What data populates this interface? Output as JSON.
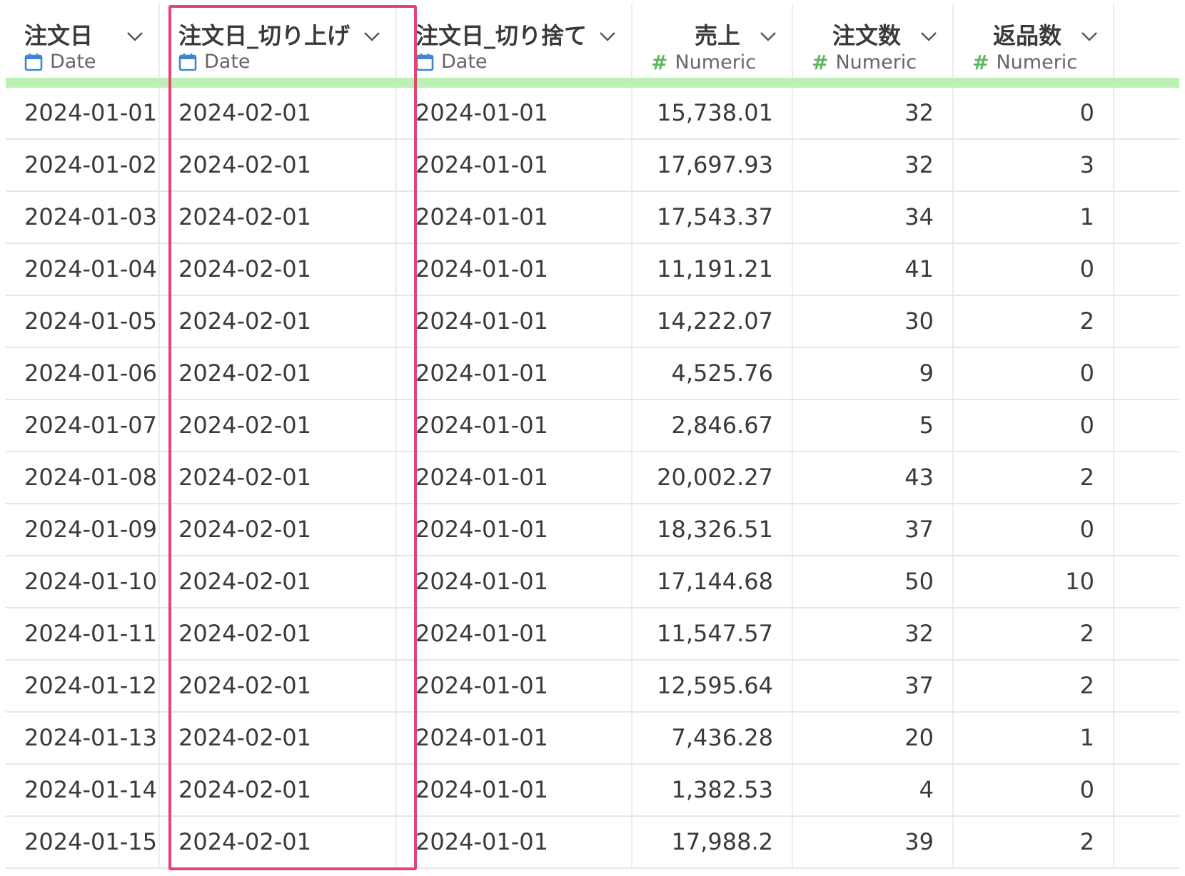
{
  "columns": [
    {
      "name": "注文日",
      "type": "Date",
      "icon": "calendar-icon",
      "align": "left"
    },
    {
      "name": "注文日_切り上げ",
      "type": "Date",
      "icon": "calendar-icon",
      "align": "left"
    },
    {
      "name": "注文日_切り捨て",
      "type": "Date",
      "icon": "calendar-icon",
      "align": "left"
    },
    {
      "name": "売上",
      "type": "Numeric",
      "icon": "hash-icon",
      "align": "right"
    },
    {
      "name": "注文数",
      "type": "Numeric",
      "icon": "hash-icon",
      "align": "right"
    },
    {
      "name": "返品数",
      "type": "Numeric",
      "icon": "hash-icon",
      "align": "right"
    }
  ],
  "rows": [
    [
      "2024-01-01",
      "2024-02-01",
      "2024-01-01",
      "15,738.01",
      "32",
      "0"
    ],
    [
      "2024-01-02",
      "2024-02-01",
      "2024-01-01",
      "17,697.93",
      "32",
      "3"
    ],
    [
      "2024-01-03",
      "2024-02-01",
      "2024-01-01",
      "17,543.37",
      "34",
      "1"
    ],
    [
      "2024-01-04",
      "2024-02-01",
      "2024-01-01",
      "11,191.21",
      "41",
      "0"
    ],
    [
      "2024-01-05",
      "2024-02-01",
      "2024-01-01",
      "14,222.07",
      "30",
      "2"
    ],
    [
      "2024-01-06",
      "2024-02-01",
      "2024-01-01",
      "4,525.76",
      "9",
      "0"
    ],
    [
      "2024-01-07",
      "2024-02-01",
      "2024-01-01",
      "2,846.67",
      "5",
      "0"
    ],
    [
      "2024-01-08",
      "2024-02-01",
      "2024-01-01",
      "20,002.27",
      "43",
      "2"
    ],
    [
      "2024-01-09",
      "2024-02-01",
      "2024-01-01",
      "18,326.51",
      "37",
      "0"
    ],
    [
      "2024-01-10",
      "2024-02-01",
      "2024-01-01",
      "17,144.68",
      "50",
      "10"
    ],
    [
      "2024-01-11",
      "2024-02-01",
      "2024-01-01",
      "11,547.57",
      "32",
      "2"
    ],
    [
      "2024-01-12",
      "2024-02-01",
      "2024-01-01",
      "12,595.64",
      "37",
      "2"
    ],
    [
      "2024-01-13",
      "2024-02-01",
      "2024-01-01",
      "7,436.28",
      "20",
      "1"
    ],
    [
      "2024-01-14",
      "2024-02-01",
      "2024-01-01",
      "1,382.53",
      "4",
      "0"
    ],
    [
      "2024-01-15",
      "2024-02-01",
      "2024-01-01",
      "17,988.2",
      "39",
      "2"
    ]
  ],
  "highlighted_column": "注文日_切り上げ",
  "colors": {
    "highlight_border": "#e0466f",
    "header_bar": "#bdf0b5",
    "date_icon": "#3d86d6",
    "numeric_icon": "#5cb85c",
    "text": "#3a3a3a"
  }
}
